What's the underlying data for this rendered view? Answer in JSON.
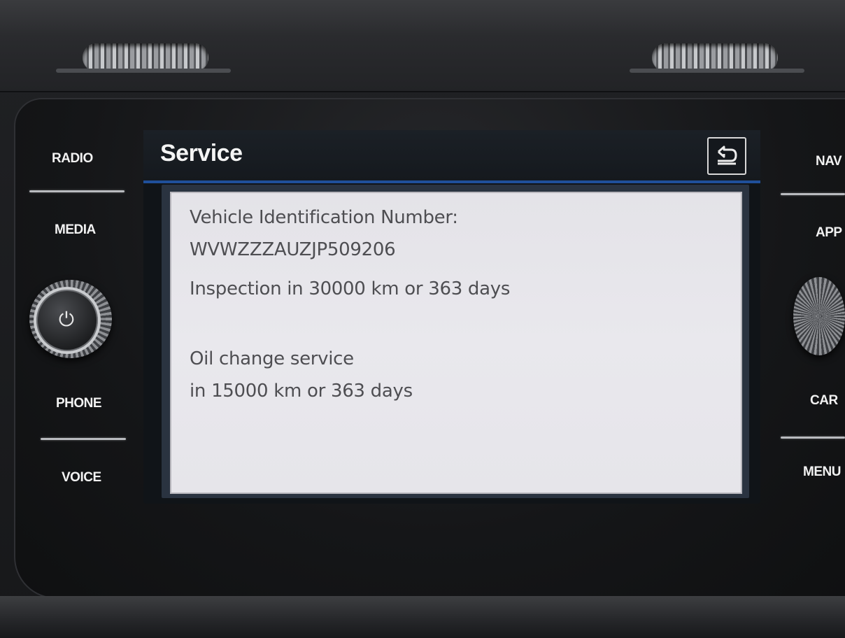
{
  "screen": {
    "title": "Service",
    "back_icon": "back-arrow-icon"
  },
  "service_info": {
    "vin_label": "Vehicle Identification Number:",
    "vin_value": "WVWZZZAUZJP509206",
    "inspection_text": "Inspection in 30000 km or 363 days",
    "oil_change_line1": "Oil change service",
    "oil_change_line2": "in 15000 km or 363 days"
  },
  "hardware_buttons": {
    "left": [
      "RADIO",
      "MEDIA",
      "PHONE",
      "VOICE"
    ],
    "right": [
      "NAV",
      "APP",
      "CAR",
      "MENU"
    ]
  },
  "colors": {
    "accent": "#1f4f9a",
    "content_bg": "#e6e5ea",
    "text": "#4e4e52"
  }
}
